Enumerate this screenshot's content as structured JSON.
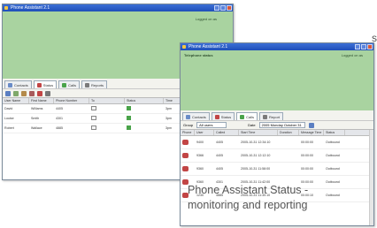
{
  "back_window": {
    "title": "Phone Assistant 2.1",
    "header_status": "Logged on as",
    "tabs": [
      {
        "label": "Contacts",
        "color": "#6a8cc7"
      },
      {
        "label": "Status",
        "color": "#c24545"
      },
      {
        "label": "Calls",
        "color": "#4aa34a"
      },
      {
        "label": "Reports",
        "color": "#7a7a7a"
      }
    ],
    "columns": [
      "User Name",
      "First Name",
      "Phone Number",
      "To",
      "Status",
      "Time"
    ],
    "rows": [
      {
        "user": "David",
        "first": "Williams",
        "phone": "4405",
        "time": "3pm"
      },
      {
        "user": "Louise",
        "first": "Smith",
        "phone": "4301",
        "time": "3pm"
      },
      {
        "user": "Robert",
        "first": "Wallace",
        "phone": "4885",
        "time": "3pm"
      }
    ]
  },
  "front_window": {
    "title": "Phone Assistant 2.1",
    "header_name": "Telephone status",
    "header_status": "Logged on as",
    "tabs": [
      {
        "label": "Contacts",
        "color": "#6a8cc7"
      },
      {
        "label": "Status",
        "color": "#c24545"
      },
      {
        "label": "Calls",
        "color": "#4aa34a"
      },
      {
        "label": "Report",
        "color": "#7a7a7a"
      }
    ],
    "filter_label": "Group",
    "filter_value": "All users",
    "date_label": "Date",
    "date_value": "2005 Monday October 31",
    "columns": [
      "Phone",
      "User",
      "Called",
      "Start Time",
      "Duration",
      "Message Time",
      "Status"
    ],
    "rows": [
      {
        "user": "9400",
        "called": "4405",
        "start": "2005-10-31 12:34:10",
        "dur": "00:00:00",
        "status": "Outbound"
      },
      {
        "user": "9366",
        "called": "4405",
        "start": "2005-10-31 12:12:10",
        "dur": "00:00:00",
        "status": "Outbound"
      },
      {
        "user": "9360",
        "called": "4405",
        "start": "2005-10-31 11:58:00",
        "dur": "00:00:00",
        "status": "Outbound"
      },
      {
        "user": "9360",
        "called": "4301",
        "start": "2005-10-31 11:42:00",
        "dur": "00:00:00",
        "status": "Outbound"
      },
      {
        "user": "1230",
        "called": "4885",
        "start": "2005-10-31 11:30:10",
        "dur": "00:00:10",
        "status": "Outbound"
      }
    ]
  },
  "caption": {
    "line1": "Phone Assistant Status -",
    "line2": "monitoring and reporting"
  },
  "edge_text": "s",
  "colors": {
    "title_bar": "#2a5cc6",
    "header_green": "#a9d3a0",
    "phone_icon": "#c24545",
    "status_green": "#4aa34a"
  }
}
